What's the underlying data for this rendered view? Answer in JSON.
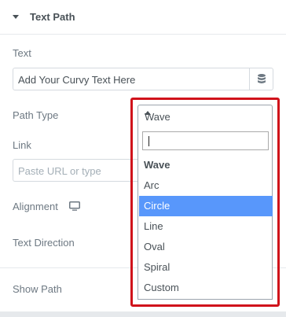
{
  "section": {
    "title": "Text Path"
  },
  "text_field": {
    "label": "Text",
    "value": "Add Your Curvy Text Here"
  },
  "path_type": {
    "label": "Path Type",
    "selected": "Wave",
    "search_value": "",
    "options": [
      {
        "label": "Wave",
        "state": "selected"
      },
      {
        "label": "Arc",
        "state": ""
      },
      {
        "label": "Circle",
        "state": "highlighted"
      },
      {
        "label": "Line",
        "state": ""
      },
      {
        "label": "Oval",
        "state": ""
      },
      {
        "label": "Spiral",
        "state": ""
      },
      {
        "label": "Custom",
        "state": ""
      }
    ]
  },
  "link": {
    "label": "Link",
    "placeholder": "Paste URL or type"
  },
  "alignment": {
    "label": "Alignment"
  },
  "text_direction": {
    "label": "Text Direction"
  },
  "show_path": {
    "label": "Show Path"
  },
  "colors": {
    "highlight_border": "#d0121b",
    "option_highlight": "#5897fb"
  }
}
